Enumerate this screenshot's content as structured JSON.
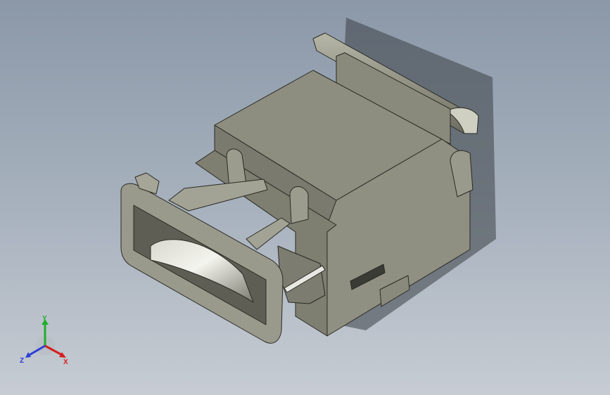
{
  "viewport": {
    "background_top": "#8b98a8",
    "background_bottom": "#c7ccd3"
  },
  "model": {
    "body_color": "#8a8a7c",
    "body_light": "#9c9c8e",
    "body_dark": "#6e6e62",
    "edge_color": "#2a2a24",
    "lens_highlight": "#f2f2ec"
  },
  "triad": {
    "x_label": "X",
    "y_label": "Y",
    "z_label": "Z",
    "x_color": "#d42020",
    "y_color": "#1fae2a",
    "z_color": "#2b3fd6",
    "icon": "coordinate-triad-icon"
  }
}
